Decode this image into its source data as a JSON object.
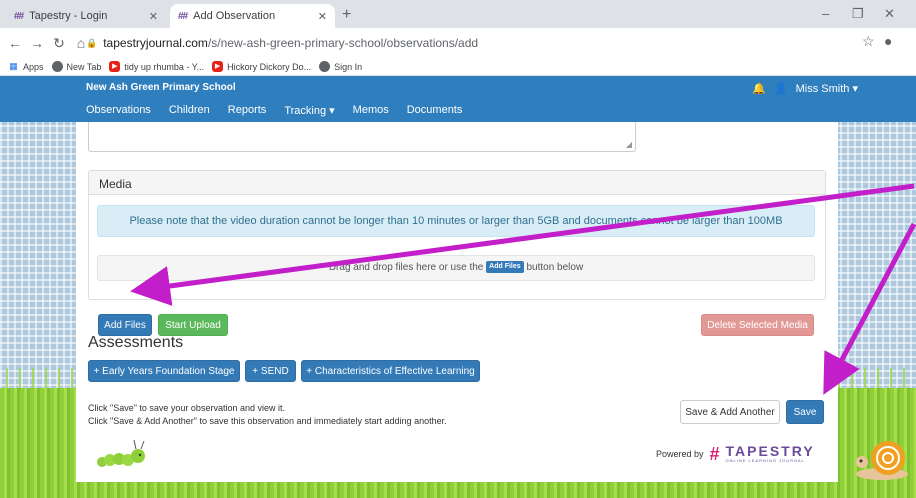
{
  "browser": {
    "tabs": [
      {
        "label": "Tapestry - Login",
        "favicon": "tapestry-icon"
      },
      {
        "label": "Add Observation",
        "favicon": "tapestry-icon"
      }
    ],
    "new_tab_symbol": "+",
    "tab_close_symbol": "✕",
    "window_controls": {
      "minimize": "–",
      "restore": "❐",
      "close": "✕"
    },
    "url": {
      "domain": "tapestryjournal.com",
      "path": "/s/new-ash-green-primary-school/observations/add"
    },
    "bookmarks": [
      {
        "label": "Apps",
        "icon": "apps-grid-icon"
      },
      {
        "label": "New Tab",
        "icon": "globe-icon"
      },
      {
        "label": "tidy up rhumba - Y...",
        "icon": "youtube-icon"
      },
      {
        "label": "Hickory Dickory Do...",
        "icon": "youtube-icon"
      },
      {
        "label": "Sign In",
        "icon": "globe-icon"
      }
    ]
  },
  "site": {
    "school_name": "New Ash Green Primary School",
    "nav": [
      "Observations",
      "Children",
      "Reports",
      "Tracking ▾",
      "Memos",
      "Documents"
    ],
    "user_name": "Miss Smith ▾"
  },
  "media": {
    "heading": "Media",
    "notice": "Please note that the video duration cannot be longer than 10 minutes or larger than 5GB and documents cannot be larger than 100MB",
    "drop_before": "Drag and drop files here or use the",
    "drop_chip": "Add Files",
    "drop_after": "button below",
    "add_files": "Add Files",
    "start_upload": "Start Upload",
    "delete_selected": "Delete Selected Media"
  },
  "assessments": {
    "heading": "Assessments",
    "buttons": [
      "+ Early Years Foundation Stage",
      "+ SEND",
      "+ Characteristics of Effective Learning"
    ]
  },
  "footer": {
    "help_1": "Click \"Save\" to save your observation and view it.",
    "help_2": "Click \"Save & Add Another\" to save this observation and immediately start adding another.",
    "save_add_another": "Save & Add Another",
    "save": "Save",
    "powered_by": "Powered by",
    "brand": "TAPESTRY",
    "brand_sub": "ONLINE LEARNING JOURNAL"
  },
  "colors": {
    "nav_blue": "#2f7ebd",
    "annotation_magenta": "#c21ec9"
  }
}
